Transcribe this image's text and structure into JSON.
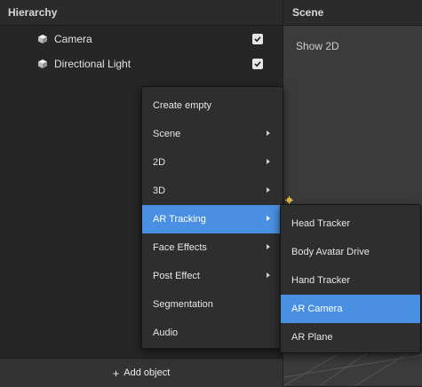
{
  "hierarchy": {
    "title": "Hierarchy",
    "items": [
      {
        "label": "Camera",
        "checked": true
      },
      {
        "label": "Directional Light",
        "checked": true
      }
    ],
    "add_object_label": "Add object",
    "add_icon": "+"
  },
  "scene": {
    "title": "Scene",
    "show2d_label": "Show 2D"
  },
  "context_menu": {
    "items": [
      {
        "label": "Create empty",
        "has_submenu": false
      },
      {
        "label": "Scene",
        "has_submenu": true
      },
      {
        "label": "2D",
        "has_submenu": true
      },
      {
        "label": "3D",
        "has_submenu": true
      },
      {
        "label": "AR Tracking",
        "has_submenu": true,
        "active": true
      },
      {
        "label": "Face Effects",
        "has_submenu": true
      },
      {
        "label": "Post Effect",
        "has_submenu": true
      },
      {
        "label": "Segmentation",
        "has_submenu": false
      },
      {
        "label": "Audio",
        "has_submenu": false
      }
    ]
  },
  "submenu": {
    "items": [
      {
        "label": "Head Tracker"
      },
      {
        "label": "Body Avatar Drive"
      },
      {
        "label": "Hand Tracker"
      },
      {
        "label": "AR Camera",
        "active": true
      },
      {
        "label": "AR Plane"
      }
    ]
  },
  "colors": {
    "accent": "#4a90e2",
    "panel": "#262626",
    "menu": "#2e2e2e"
  }
}
